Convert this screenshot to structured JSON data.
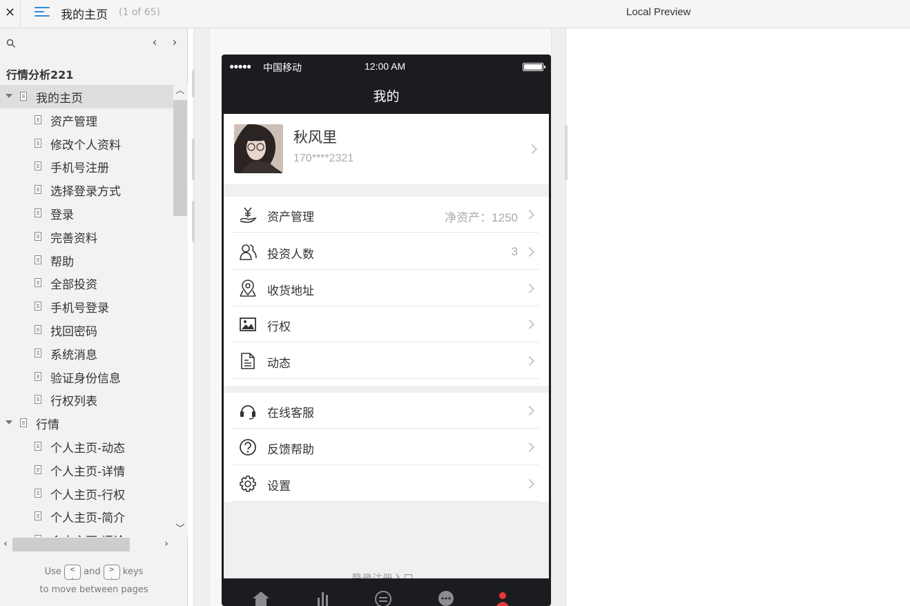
{
  "topbar": {
    "close_glyph": "✕",
    "page_title": "我的主页",
    "page_count": "(1 of 65)",
    "preview_title": "Local Preview"
  },
  "sidebar": {
    "project_title": "行情分析221",
    "tree": [
      {
        "label": "我的主页",
        "level": 0,
        "expanded": true,
        "selected": true
      },
      {
        "label": "资产管理",
        "level": 1
      },
      {
        "label": "修改个人资料",
        "level": 1
      },
      {
        "label": "手机号注册",
        "level": 1
      },
      {
        "label": "选择登录方式",
        "level": 1
      },
      {
        "label": "登录",
        "level": 1
      },
      {
        "label": "完善资料",
        "level": 1
      },
      {
        "label": "帮助",
        "level": 1
      },
      {
        "label": "全部投资",
        "level": 1
      },
      {
        "label": "手机号登录",
        "level": 1
      },
      {
        "label": "找回密码",
        "level": 1
      },
      {
        "label": "系统消息",
        "level": 1
      },
      {
        "label": "验证身份信息",
        "level": 1
      },
      {
        "label": "行权列表",
        "level": 1
      },
      {
        "label": "行情",
        "level": 0,
        "expanded": true
      },
      {
        "label": "个人主页-动态",
        "level": 1
      },
      {
        "label": "个人主页-详情",
        "level": 1
      },
      {
        "label": "个人主页-行权",
        "level": 1
      },
      {
        "label": "个人主页-简介",
        "level": 1
      },
      {
        "label": "个人主页-评论",
        "level": 1
      }
    ],
    "hint": {
      "use": "Use",
      "and": "and",
      "keys": "keys",
      "line2": "to move between pages",
      "key_prev": "<",
      "key_next": ">"
    }
  },
  "phone": {
    "status": {
      "signal": "●●●●●",
      "carrier": "中国移动",
      "time": "12:00 AM"
    },
    "nav_title": "我的",
    "profile": {
      "name": "秋风里",
      "phone": "170****2321"
    },
    "menu_group1": [
      {
        "label": "资产管理",
        "value": "净资产：1250",
        "icon": "money-hand-icon"
      },
      {
        "label": "投资人数",
        "value": "3",
        "icon": "users-icon"
      },
      {
        "label": "收货地址",
        "value": "",
        "icon": "map-pin-icon"
      },
      {
        "label": "行权",
        "value": "",
        "icon": "image-icon"
      },
      {
        "label": "动态",
        "value": "",
        "icon": "document-icon"
      }
    ],
    "menu_group2": [
      {
        "label": "在线客服",
        "icon": "headset-icon"
      },
      {
        "label": "反馈帮助",
        "icon": "question-icon"
      },
      {
        "label": "设置",
        "icon": "gear-icon"
      }
    ],
    "login_entry": "登录注册入口",
    "tabs": [
      "home-icon",
      "chart-bars-icon",
      "exchange-icon",
      "chat-icon",
      "user-icon"
    ],
    "active_tab_color": "#e8373d"
  },
  "colors": {
    "accent": "#2a8ce0",
    "dark_bar": "#1a1c1f"
  }
}
